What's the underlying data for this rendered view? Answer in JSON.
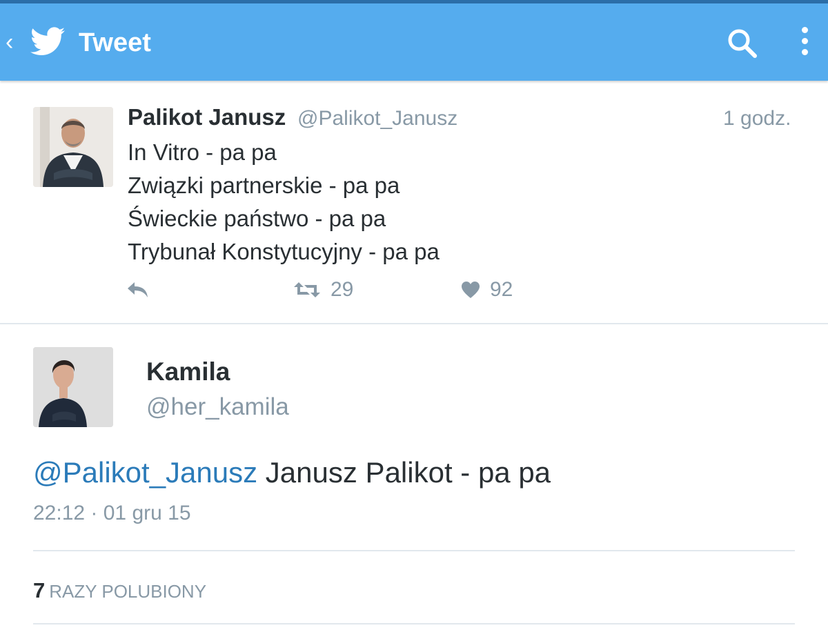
{
  "appbar": {
    "title": "Tweet",
    "back_icon": "chevron-left-icon",
    "logo_icon": "twitter-bird-icon",
    "search_icon": "search-icon",
    "more_icon": "more-vertical-icon",
    "color": "#55acee"
  },
  "tweet": {
    "author_name": "Palikot Janusz",
    "author_handle": "@Palikot_Janusz",
    "time": "1 godz.",
    "lines": [
      "In Vitro - pa pa",
      "Związki partnerskie - pa pa",
      "Świeckie państwo - pa pa",
      "Trybunał Konstytucyjny - pa pa"
    ],
    "retweet_count": "29",
    "like_count": "92"
  },
  "reply": {
    "author_name": "Kamila",
    "author_handle": "@her_kamila",
    "mention": "@Palikot_Janusz",
    "text": " Janusz Palikot - pa pa",
    "meta": "22:12 · 01 gru 15",
    "likes_count": "7",
    "likes_label": "RAZY POLUBIONY"
  }
}
